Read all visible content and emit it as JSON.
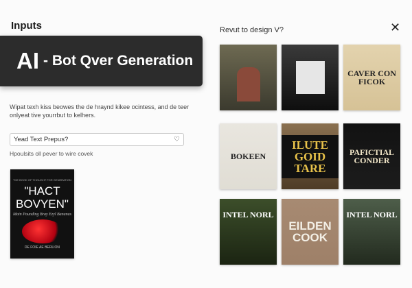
{
  "left": {
    "title": "Inputs",
    "banner": {
      "big": "AI",
      "rest": "- Bot Qver Generation"
    },
    "description": "Wipat texh kiss beowes the de hraynd kikee ocintess, and de teer onlyeat tive yourrbut to kelhers.",
    "prompt_input": {
      "value": "Yead Text Prepus?",
      "icon": "lightbulb-icon"
    },
    "hint": "Hpoulsits oll pever to wire covek",
    "cover": {
      "top": "THE BOOK OF THOUGHT FOR GENERATION",
      "title": "\"HACT BOVYEN\"",
      "subtitle": "Main Pounding Bray Ezyl Bananas",
      "author": "DE FOIE AE BERLION",
      "accent": "#c8101e"
    }
  },
  "panel": {
    "title": "Revut to design V?",
    "close_icon": "close-icon",
    "covers": [
      {
        "title": "",
        "colors": [
          "#6e6a52",
          "#3b3a2e"
        ]
      },
      {
        "title": "",
        "colors": [
          "#3a3a3a",
          "#0e0e0e"
        ]
      },
      {
        "title": "CAVER CON FICOK",
        "colors": [
          "#e3d3ae",
          "#d6c296"
        ]
      },
      {
        "title": "BOKEEN",
        "colors": [
          "#e9e6df",
          "#e0ddd4"
        ]
      },
      {
        "title": "ILUTE GOID TARE",
        "colors": [
          "#8a7050",
          "#4e3c26"
        ]
      },
      {
        "title": "PAFICTIAL CONDER",
        "colors": [
          "#121212",
          "#1c1c1c"
        ]
      },
      {
        "title": "INTEL NORL",
        "colors": [
          "#3c4e2a",
          "#1b2412"
        ]
      },
      {
        "title": "EILDEN COOK",
        "colors": [
          "#a78a72",
          "#9e8068"
        ]
      },
      {
        "title": "INTEL NORL",
        "colors": [
          "#4e5e4a",
          "#222a1e"
        ]
      }
    ]
  }
}
